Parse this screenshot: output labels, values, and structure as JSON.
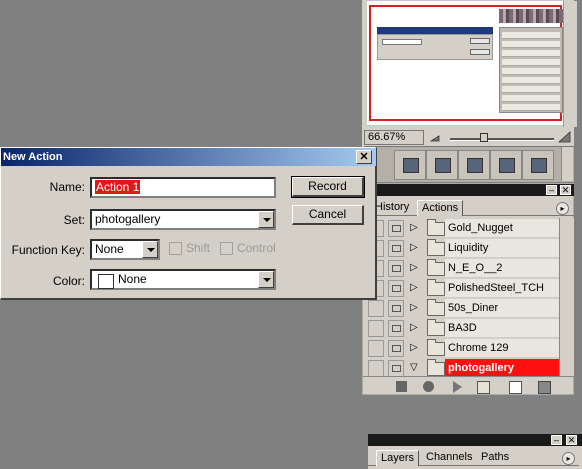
{
  "dialog": {
    "title": "New Action",
    "close_glyph": "✕",
    "name_label": "Name:",
    "name_value": "Action 1",
    "set_label": "Set:",
    "set_value": "photogallery",
    "function_key_label": "Function Key:",
    "function_key_value": "None",
    "shift_label": "Shift",
    "control_label": "Control",
    "color_label": "Color:",
    "color_value": "None",
    "record_label": "Record",
    "cancel_label": "Cancel",
    "highlight_color": "#e01818"
  },
  "navigator": {
    "zoom": "66.67%"
  },
  "actions_palette": {
    "tabs": [
      "History",
      "Actions"
    ],
    "active_tab": "Actions",
    "items": [
      {
        "name": "Gold_Nugget",
        "selected": false
      },
      {
        "name": "Liquidity",
        "selected": false
      },
      {
        "name": "N_E_O__2",
        "selected": false
      },
      {
        "name": "PolishedSteel_TCH",
        "selected": false
      },
      {
        "name": "50s_Diner",
        "selected": false
      },
      {
        "name": "BA3D",
        "selected": false
      },
      {
        "name": "Chrome 129",
        "selected": false
      },
      {
        "name": "photogallery",
        "selected": true
      }
    ],
    "selected_color": "#ff1010"
  },
  "layers_palette": {
    "tabs": [
      "Layers",
      "Channels",
      "Paths"
    ],
    "active_tab": "Layers"
  },
  "palette_glyphs": {
    "minimize": "–",
    "close": "✕",
    "menu": "▸"
  }
}
